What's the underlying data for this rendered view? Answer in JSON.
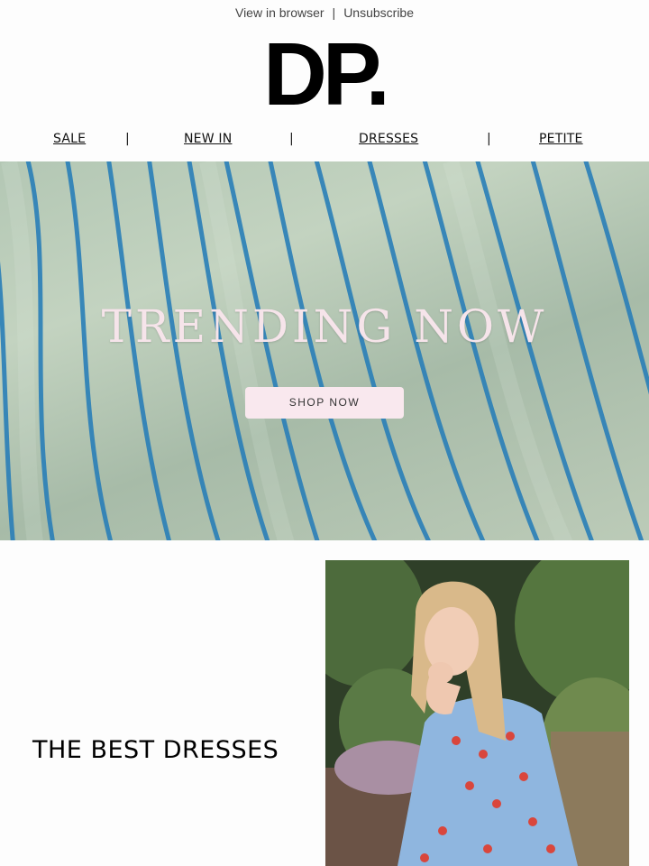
{
  "header": {
    "view_in_browser": "View in browser",
    "separator": "|",
    "unsubscribe": "Unsubscribe",
    "logo_text": "DP."
  },
  "nav": {
    "items": [
      {
        "label": "SALE"
      },
      {
        "label": "NEW IN"
      },
      {
        "label": "DRESSES"
      },
      {
        "label": "PETITE"
      }
    ],
    "divider": "|"
  },
  "hero": {
    "title": "TRENDING NOW",
    "button_label": "SHOP NOW",
    "colors": {
      "stripe": "#2a7fb8",
      "fabric": "#b8c9b6",
      "title": "#f6e4ea",
      "button_bg": "#f9e8ee"
    }
  },
  "promo": {
    "heading": "THE BEST DRESSES",
    "image_icon": "model-in-floral-dress-photo",
    "colors": {
      "dress": "#8fb6df",
      "flowers": "#d9463c",
      "foliage": "#3f5a32"
    }
  }
}
